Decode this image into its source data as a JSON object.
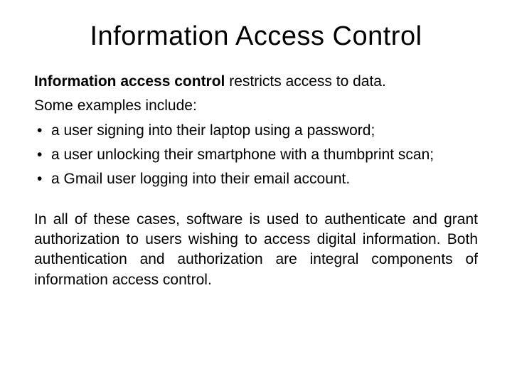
{
  "title": "Information Access Control",
  "intro_bold": "Information access control",
  "intro_rest": " restricts access to data.",
  "examples_intro": "Some examples include:",
  "bullets": [
    "a user signing into their laptop using a password;",
    "a user unlocking their smartphone with a thumbprint scan;",
    "a Gmail user logging into their email account."
  ],
  "conclusion": "In all of these cases, software is used to authenticate and grant authorization to users wishing to access digital information. Both authentication and authorization are integral components of information access control."
}
